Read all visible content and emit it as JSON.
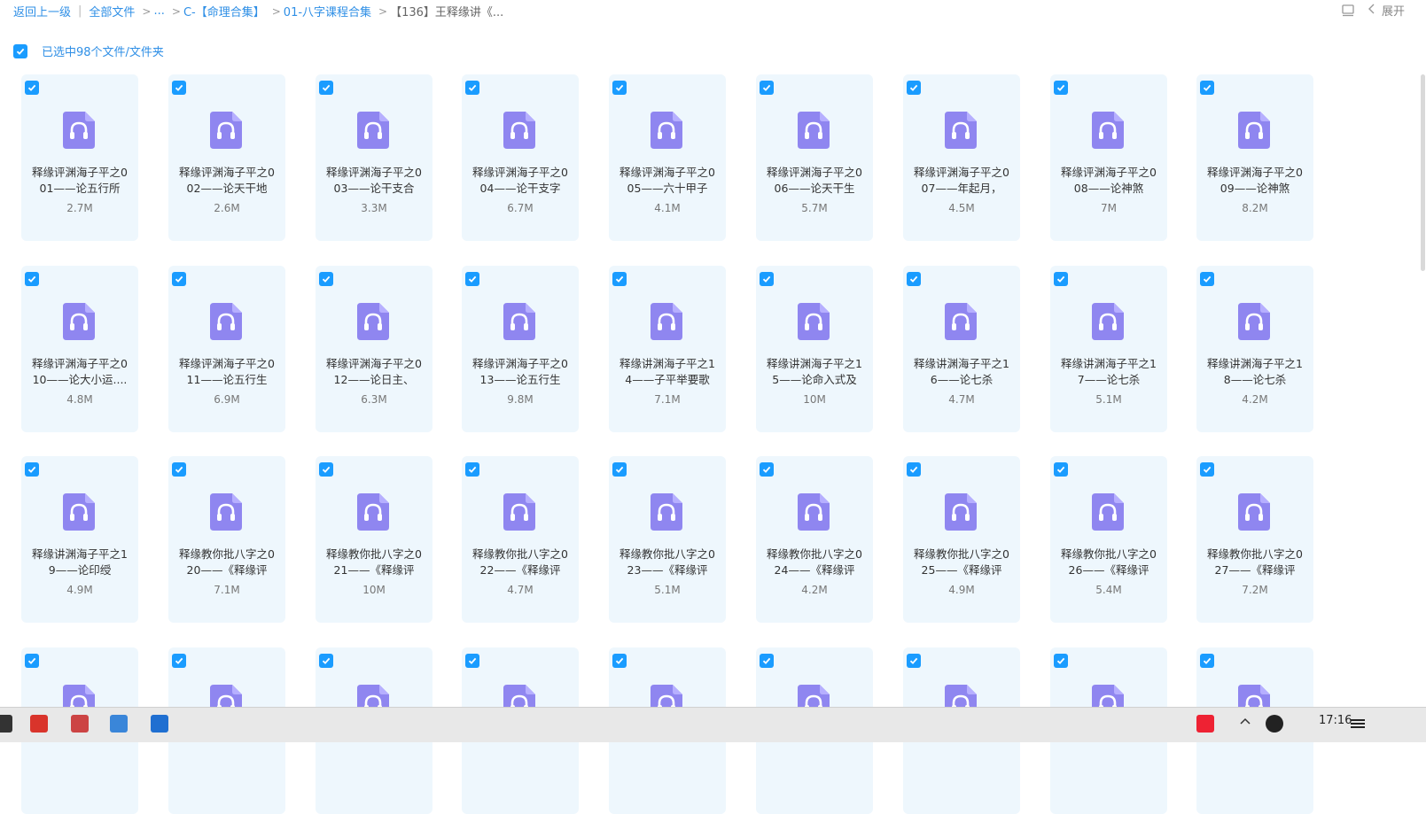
{
  "breadcrumb": {
    "back": "返回上一级",
    "all_files": "全部文件",
    "ellipsis": "...",
    "crumb1": "C-【命理合集】",
    "crumb2": "01-八字课程合集",
    "current": "【136】王释缘讲《..."
  },
  "toolbar": {
    "expand_label": "展开"
  },
  "selection": {
    "text": "已选中98个文件/文件夹"
  },
  "colors": {
    "accent": "#1a9cff",
    "card_bg": "#eef7fd",
    "icon": "#8f86f0"
  },
  "files": [
    {
      "name": "释缘评渊海子平之0\n01——论五行所",
      "size": "2.7M"
    },
    {
      "name": "释缘评渊海子平之0\n02——论天干地",
      "size": "2.6M"
    },
    {
      "name": "释缘评渊海子平之0\n03——论干支合",
      "size": "3.3M"
    },
    {
      "name": "释缘评渊海子平之0\n04——论干支字",
      "size": "6.7M"
    },
    {
      "name": "释缘评渊海子平之0\n05——六十甲子",
      "size": "4.1M"
    },
    {
      "name": "释缘评渊海子平之0\n06——论天干生",
      "size": "5.7M"
    },
    {
      "name": "释缘评渊海子平之0\n07——年起月，",
      "size": "4.5M"
    },
    {
      "name": "释缘评渊海子平之0\n08——论神煞",
      "size": "7M"
    },
    {
      "name": "释缘评渊海子平之0\n09——论神煞",
      "size": "8.2M"
    },
    {
      "name": "释缘评渊海子平之0\n10——论大小运....",
      "size": "4.8M"
    },
    {
      "name": "释缘评渊海子平之0\n11——论五行生",
      "size": "6.9M"
    },
    {
      "name": "释缘评渊海子平之0\n12——论日主、",
      "size": "6.3M"
    },
    {
      "name": "释缘评渊海子平之0\n13——论五行生",
      "size": "9.8M"
    },
    {
      "name": "释缘讲渊海子平之1\n4——子平举要歌",
      "size": "7.1M"
    },
    {
      "name": "释缘讲渊海子平之1\n5——论命入式及",
      "size": "10M"
    },
    {
      "name": "释缘讲渊海子平之1\n6——论七杀",
      "size": "4.7M"
    },
    {
      "name": "释缘讲渊海子平之1\n7——论七杀",
      "size": "5.1M"
    },
    {
      "name": "释缘讲渊海子平之1\n8——论七杀",
      "size": "4.2M"
    },
    {
      "name": "释缘讲渊海子平之1\n9——论印绶",
      "size": "4.9M"
    },
    {
      "name": "释缘教你批八字之0\n20——《释缘评",
      "size": "7.1M"
    },
    {
      "name": "释缘教你批八字之0\n21——《释缘评",
      "size": "10M"
    },
    {
      "name": "释缘教你批八字之0\n22——《释缘评",
      "size": "4.7M"
    },
    {
      "name": "释缘教你批八字之0\n23——《释缘评",
      "size": "5.1M"
    },
    {
      "name": "释缘教你批八字之0\n24——《释缘评",
      "size": "4.2M"
    },
    {
      "name": "释缘教你批八字之0\n25——《释缘评",
      "size": "4.9M"
    },
    {
      "name": "释缘教你批八字之0\n26——《释缘评",
      "size": "5.4M"
    },
    {
      "name": "释缘教你批八字之0\n27——《释缘评",
      "size": "7.2M"
    },
    {
      "name": "",
      "size": ""
    },
    {
      "name": "",
      "size": ""
    },
    {
      "name": "",
      "size": ""
    },
    {
      "name": "",
      "size": ""
    },
    {
      "name": "",
      "size": ""
    },
    {
      "name": "",
      "size": ""
    },
    {
      "name": "",
      "size": ""
    },
    {
      "name": "",
      "size": ""
    },
    {
      "name": "",
      "size": ""
    }
  ],
  "taskbar": {
    "clock": "17:16"
  }
}
